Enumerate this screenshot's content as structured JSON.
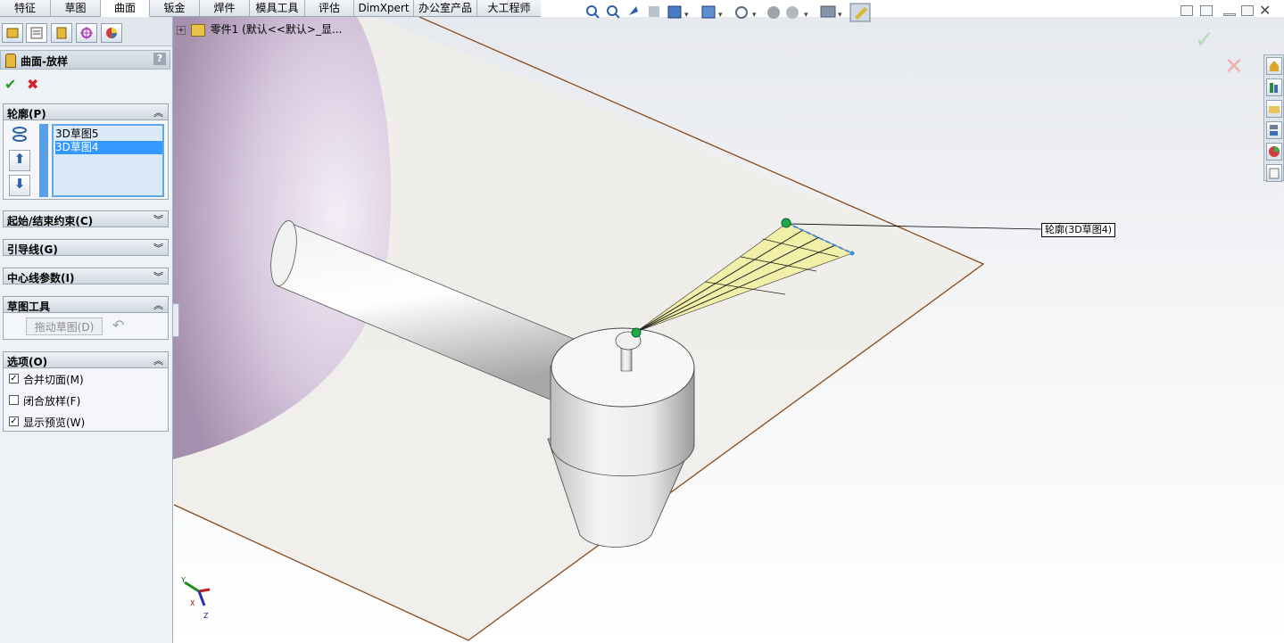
{
  "tabs": [
    "特征",
    "草图",
    "曲面",
    "钣金",
    "焊件",
    "模具工具",
    "评估",
    "DimXpert",
    "办公室产品",
    "大工程师"
  ],
  "active_tab": "曲面",
  "property_manager": {
    "title": "曲面-放样",
    "help": "?",
    "profile_section": {
      "label": "轮廓(P)",
      "items": [
        "3D草图5",
        "3D草图4"
      ],
      "selected_index": 1
    },
    "start_end_section": {
      "label": "起始/结束约束(C)"
    },
    "guide_section": {
      "label": "引导线(G)"
    },
    "centerline_section": {
      "label": "中心线参数(I)"
    },
    "sketch_tools_section": {
      "label": "草图工具",
      "drag_button": "拖动草图(D)"
    },
    "options_section": {
      "label": "选项(O)",
      "options": [
        {
          "label": "合并切面(M)",
          "checked": true
        },
        {
          "label": "闭合放样(F)",
          "checked": false
        },
        {
          "label": "显示预览(W)",
          "checked": true
        }
      ]
    }
  },
  "feature_tree": {
    "node_label": "零件1  (默认<<默认>_显..."
  },
  "graphics": {
    "callout": "轮廓(3D草图4)",
    "triad": {
      "x": "X",
      "y": "Y",
      "z": "Z"
    }
  },
  "colors": {
    "accent_blue": "#3399ff",
    "plane_edge": "#8b4a1a",
    "loft_preview": "#f2f0a8",
    "ok_green": "#2e9a2e",
    "cancel_red": "#d42222"
  }
}
